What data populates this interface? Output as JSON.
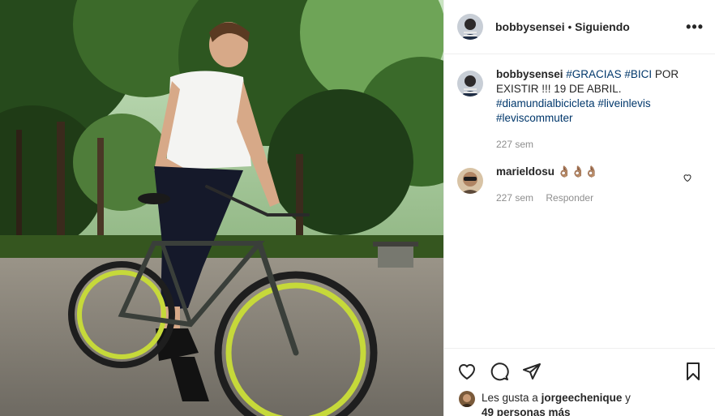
{
  "post": {
    "author": "bobbysensei",
    "separator": "•",
    "follow_status": "Siguiendo",
    "more_icon": "more-horizontal-icon"
  },
  "caption": {
    "author": "bobbysensei",
    "text_before": "",
    "tag1": "#GRACIAS",
    "tag2": "#BICI",
    "text_mid": "POR EXISTIR !!! 19 DE ABRIL.",
    "tag3": "#diamundialbicicleta",
    "tag4": "#liveinlevis",
    "tag5": "#leviscommuter",
    "time": "227 sem"
  },
  "comment": {
    "author": "marieldosu",
    "text": "👌🏽👌🏽👌🏽",
    "time": "227 sem",
    "reply": "Responder"
  },
  "likes": {
    "prefix": "Les gusta a",
    "user": "jorgeechenique",
    "conj": "y",
    "others": "49 personas más"
  },
  "colors": {
    "accent_link": "#00376b",
    "muted": "#8e8e8e",
    "divider": "#efefef"
  }
}
